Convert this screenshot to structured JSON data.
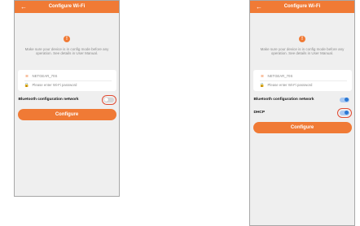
{
  "screens": [
    {
      "header": {
        "title": "Configure Wi-Fi",
        "back_icon": "←"
      },
      "message": "Make sure your device is in config mode before any operation. See details in User Manual.",
      "wifi": {
        "ssid": "NETGEAR_70S",
        "password_placeholder": "Please enter Wi-Fi password"
      },
      "bluetooth": {
        "label": "Bluetooth configuration network",
        "state": "off"
      },
      "button_label": "Configure"
    },
    {
      "header": {
        "title": "Configure Wi-Fi",
        "back_icon": "←"
      },
      "message": "Make sure your device is in config mode before any operation. See details in User Manual.",
      "wifi": {
        "ssid": "NETGEAR_70S",
        "password_placeholder": "Please enter Wi-Fi password"
      },
      "bluetooth": {
        "label": "Bluetooth configuration network",
        "state": "on"
      },
      "dhcp": {
        "label": "DHCP",
        "state": "on"
      },
      "button_label": "Configure"
    }
  ],
  "colors": {
    "accent": "#f07a35",
    "toggle_on": "#2b78d3",
    "highlight": "#e14c33"
  },
  "icons": {
    "wifi": "wifi-icon",
    "lock": "lock-icon",
    "warning": "warning-icon"
  }
}
